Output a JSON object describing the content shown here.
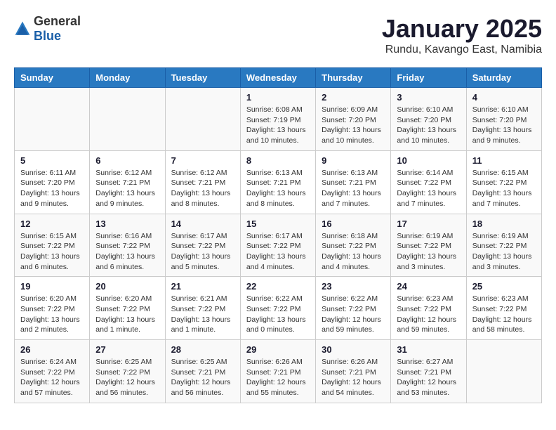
{
  "header": {
    "logo_general": "General",
    "logo_blue": "Blue",
    "title": "January 2025",
    "subtitle": "Rundu, Kavango East, Namibia"
  },
  "days_of_week": [
    "Sunday",
    "Monday",
    "Tuesday",
    "Wednesday",
    "Thursday",
    "Friday",
    "Saturday"
  ],
  "weeks": [
    [
      {
        "day": "",
        "info": ""
      },
      {
        "day": "",
        "info": ""
      },
      {
        "day": "",
        "info": ""
      },
      {
        "day": "1",
        "info": "Sunrise: 6:08 AM\nSunset: 7:19 PM\nDaylight: 13 hours and 10 minutes."
      },
      {
        "day": "2",
        "info": "Sunrise: 6:09 AM\nSunset: 7:20 PM\nDaylight: 13 hours and 10 minutes."
      },
      {
        "day": "3",
        "info": "Sunrise: 6:10 AM\nSunset: 7:20 PM\nDaylight: 13 hours and 10 minutes."
      },
      {
        "day": "4",
        "info": "Sunrise: 6:10 AM\nSunset: 7:20 PM\nDaylight: 13 hours and 9 minutes."
      }
    ],
    [
      {
        "day": "5",
        "info": "Sunrise: 6:11 AM\nSunset: 7:20 PM\nDaylight: 13 hours and 9 minutes."
      },
      {
        "day": "6",
        "info": "Sunrise: 6:12 AM\nSunset: 7:21 PM\nDaylight: 13 hours and 9 minutes."
      },
      {
        "day": "7",
        "info": "Sunrise: 6:12 AM\nSunset: 7:21 PM\nDaylight: 13 hours and 8 minutes."
      },
      {
        "day": "8",
        "info": "Sunrise: 6:13 AM\nSunset: 7:21 PM\nDaylight: 13 hours and 8 minutes."
      },
      {
        "day": "9",
        "info": "Sunrise: 6:13 AM\nSunset: 7:21 PM\nDaylight: 13 hours and 7 minutes."
      },
      {
        "day": "10",
        "info": "Sunrise: 6:14 AM\nSunset: 7:22 PM\nDaylight: 13 hours and 7 minutes."
      },
      {
        "day": "11",
        "info": "Sunrise: 6:15 AM\nSunset: 7:22 PM\nDaylight: 13 hours and 7 minutes."
      }
    ],
    [
      {
        "day": "12",
        "info": "Sunrise: 6:15 AM\nSunset: 7:22 PM\nDaylight: 13 hours and 6 minutes."
      },
      {
        "day": "13",
        "info": "Sunrise: 6:16 AM\nSunset: 7:22 PM\nDaylight: 13 hours and 6 minutes."
      },
      {
        "day": "14",
        "info": "Sunrise: 6:17 AM\nSunset: 7:22 PM\nDaylight: 13 hours and 5 minutes."
      },
      {
        "day": "15",
        "info": "Sunrise: 6:17 AM\nSunset: 7:22 PM\nDaylight: 13 hours and 4 minutes."
      },
      {
        "day": "16",
        "info": "Sunrise: 6:18 AM\nSunset: 7:22 PM\nDaylight: 13 hours and 4 minutes."
      },
      {
        "day": "17",
        "info": "Sunrise: 6:19 AM\nSunset: 7:22 PM\nDaylight: 13 hours and 3 minutes."
      },
      {
        "day": "18",
        "info": "Sunrise: 6:19 AM\nSunset: 7:22 PM\nDaylight: 13 hours and 3 minutes."
      }
    ],
    [
      {
        "day": "19",
        "info": "Sunrise: 6:20 AM\nSunset: 7:22 PM\nDaylight: 13 hours and 2 minutes."
      },
      {
        "day": "20",
        "info": "Sunrise: 6:20 AM\nSunset: 7:22 PM\nDaylight: 13 hours and 1 minute."
      },
      {
        "day": "21",
        "info": "Sunrise: 6:21 AM\nSunset: 7:22 PM\nDaylight: 13 hours and 1 minute."
      },
      {
        "day": "22",
        "info": "Sunrise: 6:22 AM\nSunset: 7:22 PM\nDaylight: 13 hours and 0 minutes."
      },
      {
        "day": "23",
        "info": "Sunrise: 6:22 AM\nSunset: 7:22 PM\nDaylight: 12 hours and 59 minutes."
      },
      {
        "day": "24",
        "info": "Sunrise: 6:23 AM\nSunset: 7:22 PM\nDaylight: 12 hours and 59 minutes."
      },
      {
        "day": "25",
        "info": "Sunrise: 6:23 AM\nSunset: 7:22 PM\nDaylight: 12 hours and 58 minutes."
      }
    ],
    [
      {
        "day": "26",
        "info": "Sunrise: 6:24 AM\nSunset: 7:22 PM\nDaylight: 12 hours and 57 minutes."
      },
      {
        "day": "27",
        "info": "Sunrise: 6:25 AM\nSunset: 7:22 PM\nDaylight: 12 hours and 56 minutes."
      },
      {
        "day": "28",
        "info": "Sunrise: 6:25 AM\nSunset: 7:21 PM\nDaylight: 12 hours and 56 minutes."
      },
      {
        "day": "29",
        "info": "Sunrise: 6:26 AM\nSunset: 7:21 PM\nDaylight: 12 hours and 55 minutes."
      },
      {
        "day": "30",
        "info": "Sunrise: 6:26 AM\nSunset: 7:21 PM\nDaylight: 12 hours and 54 minutes."
      },
      {
        "day": "31",
        "info": "Sunrise: 6:27 AM\nSunset: 7:21 PM\nDaylight: 12 hours and 53 minutes."
      },
      {
        "day": "",
        "info": ""
      }
    ]
  ]
}
